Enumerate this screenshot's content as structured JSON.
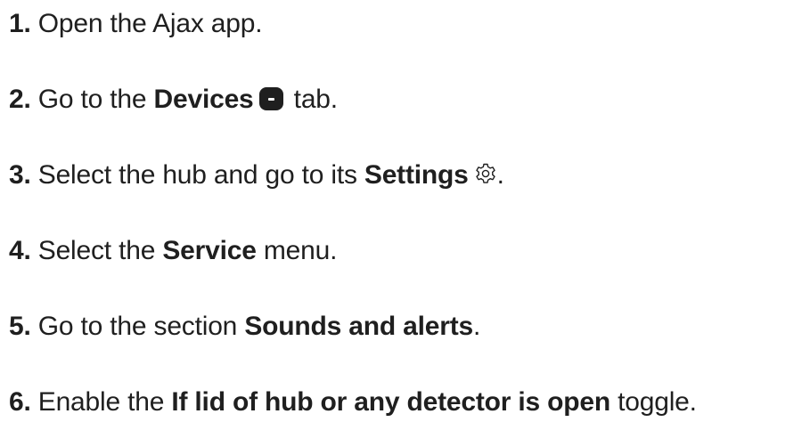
{
  "steps": [
    {
      "num": "1.",
      "pre": "Open the Ajax app."
    },
    {
      "num": "2.",
      "pre": "Go to the ",
      "bold": "Devices",
      "post": " tab.",
      "icon": "devices-icon"
    },
    {
      "num": "3.",
      "pre": "Select the hub and go to its ",
      "bold": "Settings",
      "post": ".",
      "icon": "gear-icon"
    },
    {
      "num": "4.",
      "pre": "Select the ",
      "bold": "Service",
      "post": " menu."
    },
    {
      "num": "5.",
      "pre": "Go to the section ",
      "bold": "Sounds and alerts",
      "post": "."
    },
    {
      "num": "6.",
      "pre": "Enable the ",
      "bold": "If lid of hub or any detector is open",
      "post": " toggle."
    }
  ]
}
